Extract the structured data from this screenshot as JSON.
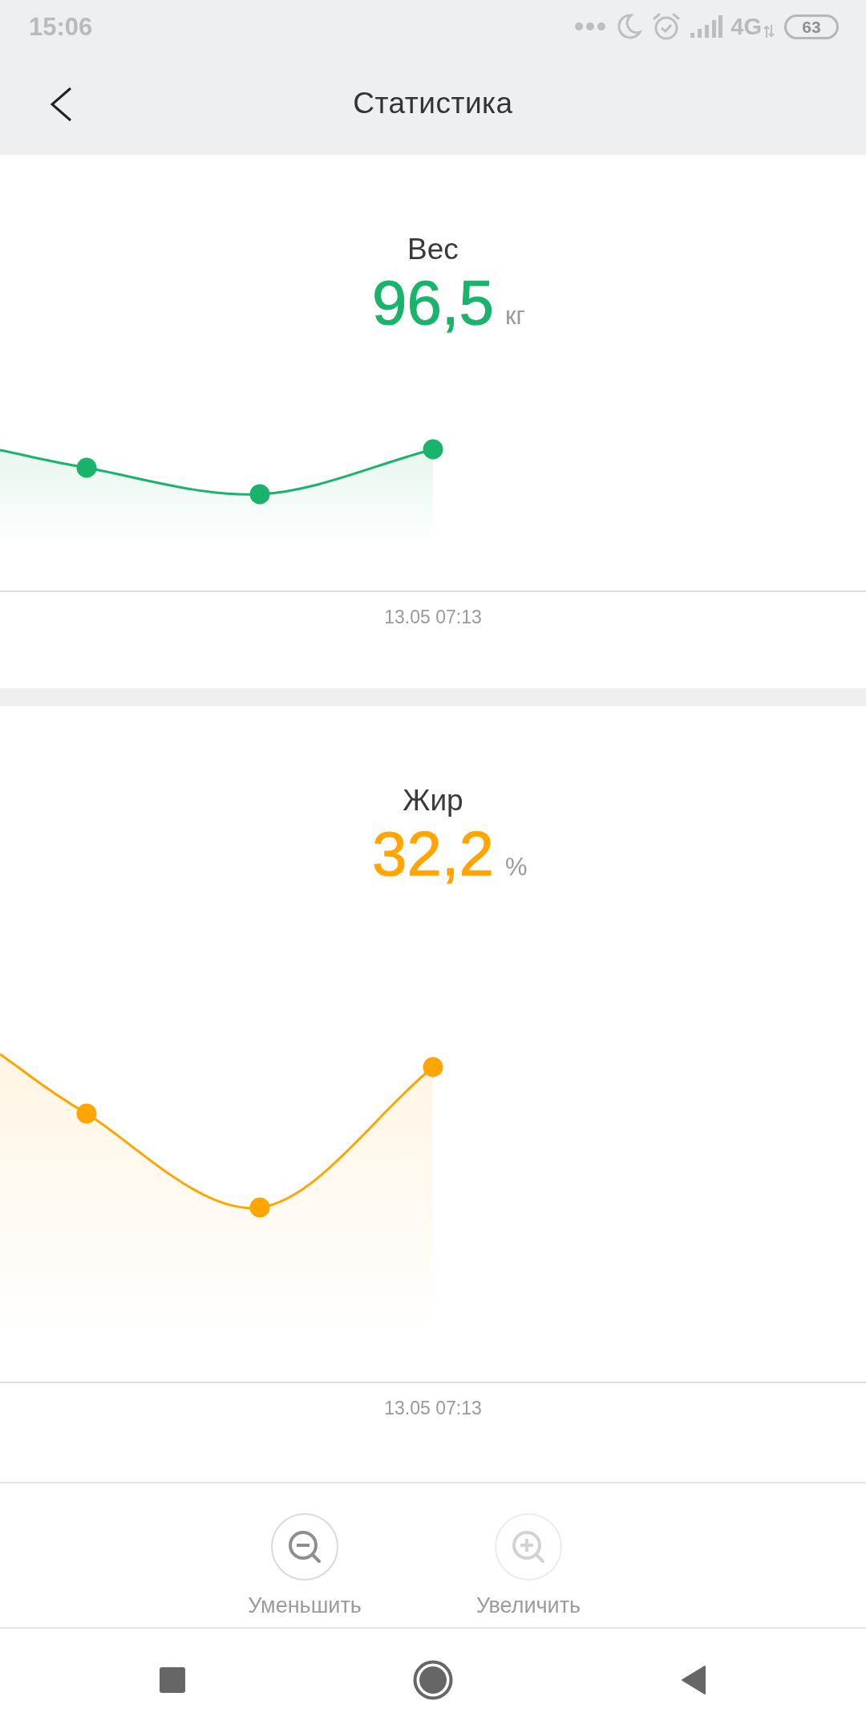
{
  "status_bar": {
    "time": "15:06",
    "network": "4G",
    "battery": "63"
  },
  "header": {
    "title": "Статистика"
  },
  "metrics": [
    {
      "label": "Вес",
      "value": "96,5",
      "unit": "кг",
      "color": "#19b36b",
      "date_label": "13.05 07:13"
    },
    {
      "label": "Жир",
      "value": "32,2",
      "unit": "%",
      "color": "#ffa500",
      "date_label": "13.05 07:13"
    }
  ],
  "zoom_controls": [
    {
      "kind": "zoom-out",
      "label": "Уменьшить",
      "disabled": false
    },
    {
      "kind": "zoom-in",
      "label": "Увеличить",
      "disabled": true
    }
  ]
}
